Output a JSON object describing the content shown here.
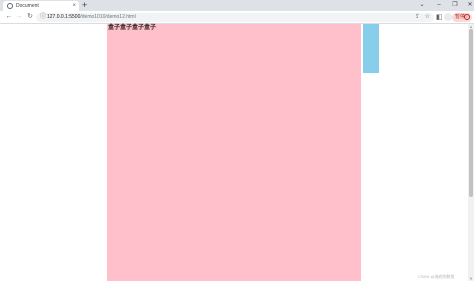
{
  "browser": {
    "tab": {
      "title": "Document",
      "favicon": "globe-icon",
      "close": "×"
    },
    "new_tab": "+",
    "window_controls": {
      "menu": "⌄",
      "minimize": "–",
      "maximize": "❐",
      "close": "✕"
    },
    "nav": {
      "back": "←",
      "forward": "→",
      "reload": "↻"
    },
    "address": {
      "host": "127.0.0.1:5500",
      "path": "/demo1010/demo12.html",
      "lock": "ⓘ"
    },
    "omnibox_icons": {
      "share": "⇪",
      "star": "☆"
    },
    "side_panel": "◧",
    "pause": {
      "label": "暂停",
      "icon": "i"
    }
  },
  "page": {
    "box_text": "盒子盒子盒子盒子",
    "box_color": "#ffc0cb",
    "side_box_color": "#87ceeb"
  },
  "watermark": "CSDN @海底的鲸鱼"
}
